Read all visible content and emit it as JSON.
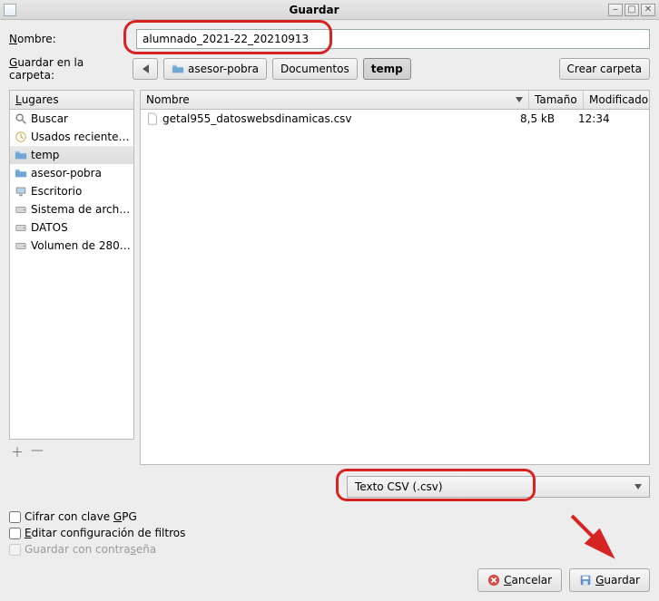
{
  "window": {
    "title": "Guardar"
  },
  "name_row": {
    "label": "Nombre:",
    "value": "alumnado_2021-22_20210913"
  },
  "folder_row": {
    "label": "Guardar en la carpeta:",
    "segments": [
      "asesor-pobra",
      "Documentos",
      "temp"
    ],
    "create_folder": "Crear carpeta"
  },
  "places": {
    "header": "Lugares",
    "items": [
      {
        "label": "Buscar",
        "icon": "search"
      },
      {
        "label": "Usados reciente…",
        "icon": "clock"
      },
      {
        "label": "temp",
        "icon": "folder",
        "selected": true
      },
      {
        "label": "asesor-pobra",
        "icon": "folder"
      },
      {
        "label": "Escritorio",
        "icon": "desktop"
      },
      {
        "label": "Sistema de arch…",
        "icon": "drive"
      },
      {
        "label": "DATOS",
        "icon": "drive"
      },
      {
        "label": "Volumen de 280…",
        "icon": "drive"
      }
    ]
  },
  "filelist": {
    "cols": {
      "name": "Nombre",
      "size": "Tamaño",
      "modified": "Modificado"
    },
    "rows": [
      {
        "name": "getal955_datoswebsdinamicas.csv",
        "size": "8,5 kB",
        "modified": "12:34"
      }
    ]
  },
  "filetype": {
    "label": "Texto CSV (.csv)"
  },
  "checks": {
    "gpg": "Cifrar con clave GPG",
    "filters": "Editar configuración de filtros",
    "password": "Guardar con contraseña"
  },
  "footer": {
    "cancel": "Cancelar",
    "save": "Guardar"
  }
}
